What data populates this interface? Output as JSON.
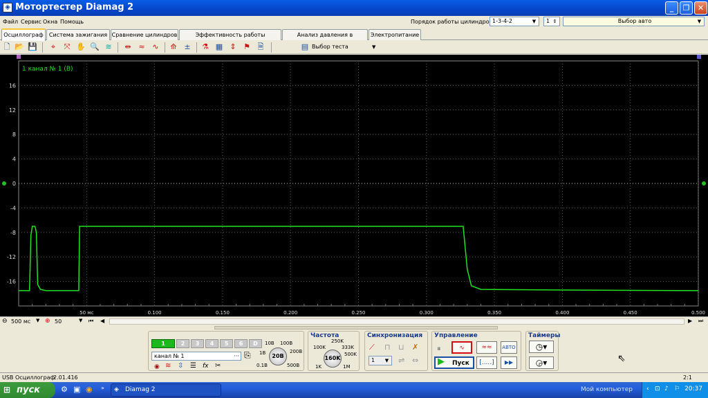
{
  "window": {
    "title": "Мотортестер Diamag 2",
    "icon": "app-icon"
  },
  "menu": {
    "items": [
      "Файл",
      "Сервис",
      "Окна",
      "Помощь"
    ]
  },
  "cylinder_order": {
    "label": "Порядок работы цилиндров",
    "value": "1-3-4-2",
    "cylinder": "1",
    "auto": "Выбор авто"
  },
  "tabs": [
    "Осциллограф",
    "Система зажигания",
    "Сравнение цилиндров",
    "Эффективность работы цилиндров",
    "Анализ давления в цилиндре",
    "Электропитание"
  ],
  "toolbar": {
    "test_select": "Выбор теста"
  },
  "scope": {
    "channel_label": "1  канал № 1 (В)",
    "trace_color": "#22e022",
    "grid_color": "#5a5a5a"
  },
  "chart_data": {
    "type": "line",
    "title": "1  канал № 1 (В)",
    "xlabel": "",
    "ylabel": "",
    "xlim": [
      0.0,
      0.5
    ],
    "ylim": [
      -20,
      20
    ],
    "y_ticks": [
      16,
      12,
      8,
      4,
      0,
      -4,
      -8,
      -12,
      -16
    ],
    "x_tick_labels": [
      "50 мс",
      "0.100",
      "0.150",
      "0.200",
      "0.250",
      "0.300",
      "0.350",
      "0.400",
      "0.450",
      "0.500"
    ],
    "x_ticks": [
      0.05,
      0.1,
      0.15,
      0.2,
      0.25,
      0.3,
      0.35,
      0.4,
      0.45,
      0.5
    ],
    "grid": true,
    "series": [
      {
        "x": [
          0.0,
          0.008,
          0.009,
          0.01,
          0.011,
          0.012,
          0.013,
          0.014,
          0.016,
          0.02,
          0.04,
          0.0442,
          0.0448,
          0.05,
          0.1,
          0.2,
          0.3,
          0.3,
          0.326,
          0.327,
          0.33,
          0.333,
          0.34,
          0.4,
          0.5
        ],
        "y": [
          -17.5,
          -17.5,
          -8.5,
          -7,
          -7,
          -7,
          -8,
          -16.5,
          -17.3,
          -17.5,
          -17.5,
          -17.5,
          -7,
          -7,
          -7,
          -7,
          -7,
          -7,
          -7,
          -7,
          -14,
          -16.7,
          -17.3,
          -17.4,
          -17.5
        ]
      }
    ]
  },
  "timebase": {
    "value": "500 мс",
    "points": "50"
  },
  "channels": {
    "buttons": [
      "1",
      "2",
      "3",
      "4",
      "5",
      "6",
      "D"
    ],
    "name": "канал № 1"
  },
  "voltage": {
    "labels": [
      "10В",
      "100В",
      "1В",
      "200В",
      "0.1В",
      "500В"
    ],
    "value": "20В"
  },
  "frequency": {
    "title": "Частота",
    "labels": [
      "250K",
      "100K",
      "333K",
      "500K",
      "1K",
      "1M"
    ],
    "value": "160K"
  },
  "sync": {
    "title": "Синхронизация",
    "value": "1"
  },
  "control": {
    "title": "Управление",
    "start": "Пуск",
    "auto": "АВТО"
  },
  "timers": {
    "title": "Таймеры"
  },
  "statusbar": {
    "left": "USB Осциллограф",
    "version": "2.01.416",
    "right": "2:1"
  },
  "taskbar": {
    "start": "пуск",
    "task": "Diamag 2",
    "mycomputer": "Мой компьютер",
    "clock": "20:37"
  }
}
